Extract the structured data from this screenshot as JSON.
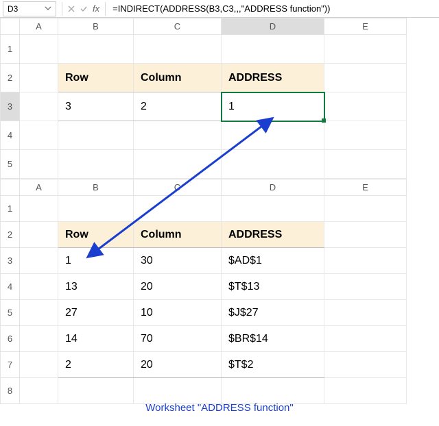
{
  "namebox": "D3",
  "formula": "=INDIRECT(ADDRESS(B3,C3,,,\"ADDRESS function\"))",
  "cols": [
    "A",
    "B",
    "C",
    "D",
    "E"
  ],
  "grid1": {
    "rows": [
      "1",
      "2",
      "3",
      "4",
      "5"
    ],
    "headers": {
      "row": "Row",
      "col": "Column",
      "addr": "ADDRESS"
    },
    "data": [
      {
        "row": "3",
        "col": "2",
        "addr": "1"
      }
    ]
  },
  "grid2": {
    "rows": [
      "1",
      "2",
      "3",
      "4",
      "5",
      "6",
      "7",
      "8"
    ],
    "headers": {
      "row": "Row",
      "col": "Column",
      "addr": "ADDRESS"
    },
    "data": [
      {
        "row": "1",
        "col": "30",
        "addr": "$AD$1"
      },
      {
        "row": "13",
        "col": "20",
        "addr": "$T$13"
      },
      {
        "row": "27",
        "col": "10",
        "addr": "$J$27"
      },
      {
        "row": "14",
        "col": "70",
        "addr": "$BR$14"
      },
      {
        "row": "2",
        "col": "20",
        "addr": "$T$2"
      }
    ]
  },
  "caption": "Worksheet \"ADDRESS function\"",
  "chart_data": {
    "type": "table",
    "title": "INDIRECT + ADDRESS example across two sheets",
    "tables": [
      {
        "name": "top",
        "columns": [
          "Row",
          "Column",
          "ADDRESS"
        ],
        "rows": [
          [
            3,
            2,
            1
          ]
        ]
      },
      {
        "name": "ADDRESS function",
        "columns": [
          "Row",
          "Column",
          "ADDRESS"
        ],
        "rows": [
          [
            1,
            30,
            "$AD$1"
          ],
          [
            13,
            20,
            "$T$13"
          ],
          [
            27,
            10,
            "$J$27"
          ],
          [
            14,
            70,
            "$BR$14"
          ],
          [
            2,
            20,
            "$T$2"
          ]
        ]
      }
    ]
  }
}
